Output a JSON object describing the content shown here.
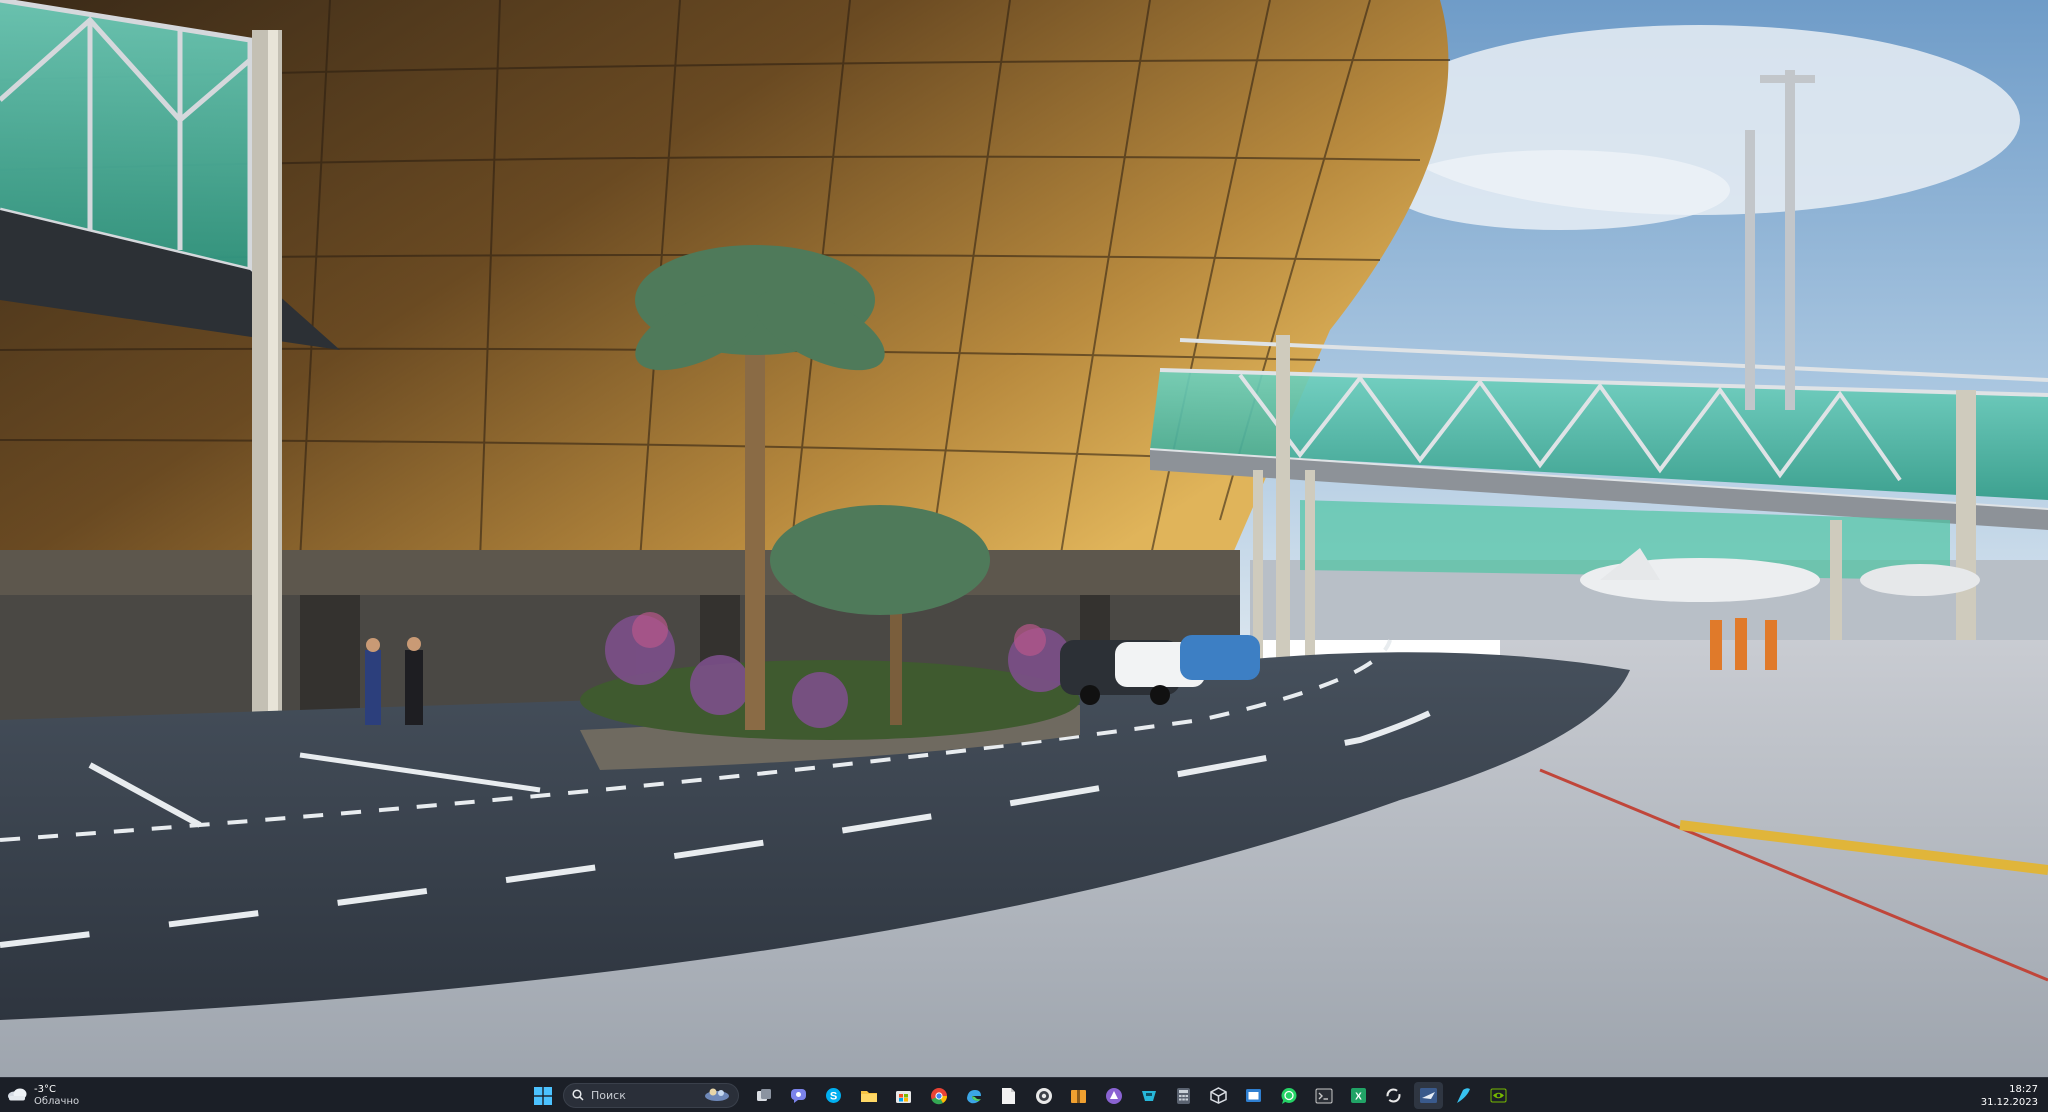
{
  "taskbar": {
    "weather": {
      "temperature": "-3°C",
      "condition": "Облачно",
      "icon": "cloud-icon"
    },
    "search": {
      "placeholder": "Поиск"
    },
    "apps": [
      {
        "name": "start-button",
        "icon": "windows-logo-icon",
        "color": "#4cc2ff"
      },
      {
        "name": "task-view",
        "icon": "task-view-icon",
        "color": "#d9dde3"
      },
      {
        "name": "chat",
        "icon": "chat-icon",
        "color": "#7b83eb"
      },
      {
        "name": "skype",
        "icon": "skype-icon",
        "color": "#00aff0"
      },
      {
        "name": "file-explorer",
        "icon": "folder-icon",
        "color": "#f7c544"
      },
      {
        "name": "store",
        "icon": "store-icon",
        "color": "#e8e8e8"
      },
      {
        "name": "chrome",
        "icon": "chrome-icon",
        "color": "#e94235"
      },
      {
        "name": "edge",
        "icon": "edge-icon",
        "color": "#3ba6e6"
      },
      {
        "name": "notepad",
        "icon": "document-icon",
        "color": "#f2f2f2"
      },
      {
        "name": "obs",
        "icon": "record-icon",
        "color": "#e8e8e8"
      },
      {
        "name": "archive",
        "icon": "archive-icon",
        "color": "#f0a030"
      },
      {
        "name": "app-purple",
        "icon": "purple-app-icon",
        "color": "#8a63d2"
      },
      {
        "name": "app-cyan",
        "icon": "cyan-app-icon",
        "color": "#27b7d9"
      },
      {
        "name": "calculator",
        "icon": "calculator-icon",
        "color": "#9aa4b1"
      },
      {
        "name": "cube-app",
        "icon": "cube-icon",
        "color": "#d9dde3"
      },
      {
        "name": "app-window",
        "icon": "window-app-icon",
        "color": "#2f7fd0"
      },
      {
        "name": "whatsapp",
        "icon": "whatsapp-icon",
        "color": "#25d366"
      },
      {
        "name": "terminal",
        "icon": "terminal-icon",
        "color": "#c9c9c9"
      },
      {
        "name": "excel",
        "icon": "spreadsheet-icon",
        "color": "#21a366"
      },
      {
        "name": "sync-app",
        "icon": "sync-icon",
        "color": "#e8e8e8"
      },
      {
        "name": "flight-simulator",
        "icon": "flight-sim-icon",
        "color": "#3a5a8c"
      },
      {
        "name": "app-blue",
        "icon": "feather-icon",
        "color": "#37c2f0"
      },
      {
        "name": "nvidia",
        "icon": "nvidia-icon",
        "color": "#76b900"
      }
    ],
    "clock": {
      "time": "18:27",
      "date": "31.12.2023"
    }
  }
}
